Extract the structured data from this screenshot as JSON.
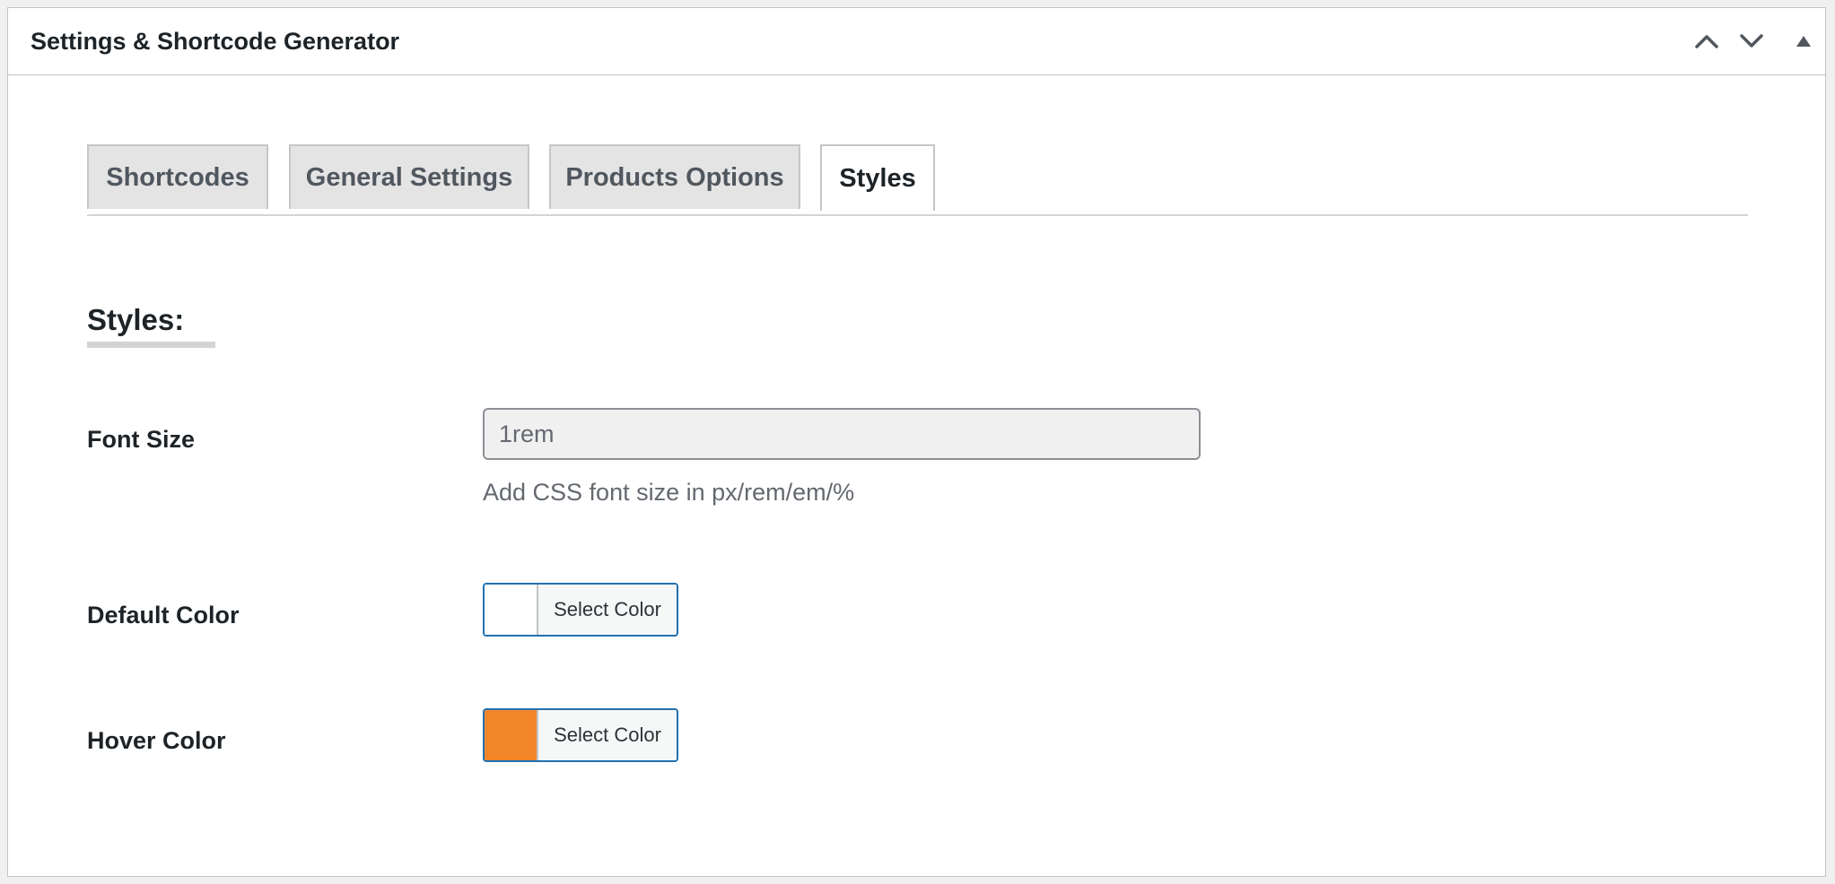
{
  "panel": {
    "title": "Settings & Shortcode Generator",
    "actions": [
      {
        "name": "move-up",
        "icon": "chevron-up-icon"
      },
      {
        "name": "move-down",
        "icon": "chevron-down-icon"
      },
      {
        "name": "toggle-panel",
        "icon": "triangle-up-icon"
      }
    ]
  },
  "tabs": [
    {
      "label": "Shortcodes",
      "active": false
    },
    {
      "label": "General Settings",
      "active": false
    },
    {
      "label": "Products Options",
      "active": false
    },
    {
      "label": "Styles",
      "active": true
    }
  ],
  "section": {
    "heading": "Styles:"
  },
  "fields": {
    "font_size": {
      "label": "Font Size",
      "value": "1rem",
      "description": "Add CSS font size in px/rem/em/%"
    },
    "default_color": {
      "label": "Default Color",
      "swatch": "#ffffff",
      "button": "Select Color"
    },
    "hover_color": {
      "label": "Hover Color",
      "swatch": "#f4862a",
      "button": "Select Color"
    }
  },
  "colors": {
    "accent": "#2271b1",
    "border": "#c3c4c7",
    "tab_inactive_bg": "#e4e4e5"
  }
}
